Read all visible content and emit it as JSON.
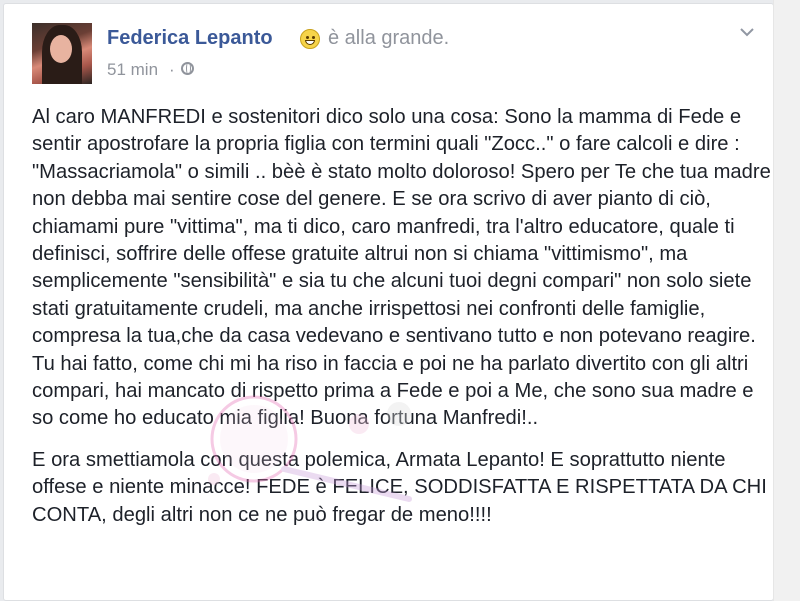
{
  "post": {
    "author": "Federica Lepanto",
    "status": "è alla grande.",
    "timestamp": "51 min",
    "separator": "·",
    "paragraphs": [
      "Al caro MANFREDI e sostenitori dico solo una cosa: Sono la mamma di Fede e sentir apostrofare la propria figlia con termini quali \"Zocc..\" o fare calcoli e dire : \"Massacriamola\" o simili .. bèè è stato molto doloroso! Spero per Te che tua madre non debba mai sentire cose del genere. E se ora scrivo di aver pianto di ciò, chiamami pure \"vittima\", ma ti dico, caro manfredi, tra l'altro educatore, quale ti definisci, soffrire delle offese gratuite altrui non si chiama \"vittimismo\", ma semplicemente \"sensibilità\" e sia tu che alcuni tuoi degni compari\" non solo siete stati gratuitamente crudeli, ma anche irrispettosi nei confronti delle famiglie, compresa la tua,che da casa vedevano e sentivano tutto e non potevano reagire. Tu hai fatto, come chi mi ha riso in faccia e poi ne ha parlato divertito con gli altri compari, hai mancato di rispetto prima a Fede e poi a Me, che sono sua madre e so come ho educato mia figlia! Buona fortuna Manfredi!..",
      "E ora smettiamola con questa polemica, Armata Lepanto! E soprattutto niente offese e niente minacce! FEDE è FELICE, SODDISFATTA E RISPETTATA DA CHI CONTA, degli altri non ce ne può fregar de meno!!!!"
    ],
    "watermark_text": "Vicolo News"
  },
  "icons": {
    "feeling": "grinning-face-icon",
    "privacy": "globe-icon",
    "menu": "chevron-down-icon"
  },
  "colors": {
    "name": "#3b5998",
    "meta": "#90949c",
    "text": "#1d2129",
    "watermark": "#e56bb3"
  }
}
